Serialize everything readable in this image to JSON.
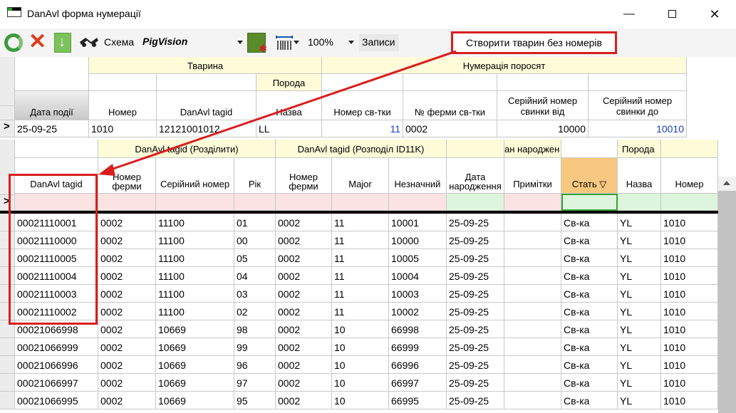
{
  "window": {
    "title": "DanAvl форма нумерації",
    "min": "—",
    "max": "",
    "close": "✕"
  },
  "toolbar": {
    "scheme_label": "Схема",
    "scheme_value": "PigVision",
    "zoom_value": "100%",
    "records_label": "Записи",
    "create_button": "Створити тварин без номерів",
    "icons": [
      "refresh-icon",
      "delete-icon",
      "download-icon",
      "scheme-icon",
      "calculator-icon",
      "barcode-icon"
    ]
  },
  "header_grid": {
    "group_animal": "Тварина",
    "group_litter": "Нумерація поросят",
    "breed_group": "Порода",
    "col_event_date": "Дата події",
    "col_number": "Номер",
    "col_tagid": "DanAvl tagid",
    "col_name": "Назва",
    "col_sow_number": "Номер св-тки",
    "col_farm_sow": "№ ферми св-тки",
    "col_serial_from": "Серійний номер свинки від",
    "col_serial_to": "Серійний номер свинки до",
    "row": {
      "marker": ">",
      "event_date": "25-09-25",
      "number": "1010",
      "tagid": "12121001012",
      "name": "LL",
      "sow_number": "11",
      "farm_sow": "0002",
      "serial_from": "10000",
      "serial_to": "10010"
    }
  },
  "lower_grid": {
    "group_split": "DanAvl tagid (Розділити)",
    "group_distribution": "DanAvl tagid (Розподіл ID11K)",
    "group_birth": "ан народжен",
    "group_breed": "Порода",
    "columns": [
      "DanAvl tagid",
      "Номер ферми",
      "Серійний номер",
      "Рік",
      "Номер ферми",
      "Major",
      "Незначний",
      "Дата народження",
      "Примітки",
      "Стать",
      "Назва",
      "Номер"
    ],
    "new_row_marker": ">",
    "rows": [
      [
        "00021110001",
        "0002",
        "11100",
        "01",
        "0002",
        "11",
        "10001",
        "25-09-25",
        "",
        "Св-ка",
        "YL",
        "1010"
      ],
      [
        "00021110000",
        "0002",
        "11100",
        "00",
        "0002",
        "11",
        "10000",
        "25-09-25",
        "",
        "Св-ка",
        "YL",
        "1010"
      ],
      [
        "00021110005",
        "0002",
        "11100",
        "05",
        "0002",
        "11",
        "10005",
        "25-09-25",
        "",
        "Св-ка",
        "YL",
        "1010"
      ],
      [
        "00021110004",
        "0002",
        "11100",
        "04",
        "0002",
        "11",
        "10004",
        "25-09-25",
        "",
        "Св-ка",
        "YL",
        "1010"
      ],
      [
        "00021110003",
        "0002",
        "11100",
        "03",
        "0002",
        "11",
        "10003",
        "25-09-25",
        "",
        "Св-ка",
        "YL",
        "1010"
      ],
      [
        "00021110002",
        "0002",
        "11100",
        "02",
        "0002",
        "11",
        "10002",
        "25-09-25",
        "",
        "Св-ка",
        "YL",
        "1010"
      ],
      [
        "00021066998",
        "0002",
        "10669",
        "98",
        "0002",
        "10",
        "66998",
        "25-09-25",
        "",
        "Св-ка",
        "YL",
        "1010"
      ],
      [
        "00021066999",
        "0002",
        "10669",
        "99",
        "0002",
        "10",
        "66999",
        "25-09-25",
        "",
        "Св-ка",
        "YL",
        "1010"
      ],
      [
        "00021066996",
        "0002",
        "10669",
        "96",
        "0002",
        "10",
        "66996",
        "25-09-25",
        "",
        "Св-ка",
        "YL",
        "1010"
      ],
      [
        "00021066997",
        "0002",
        "10669",
        "97",
        "0002",
        "10",
        "66997",
        "25-09-25",
        "",
        "Св-ка",
        "YL",
        "1010"
      ],
      [
        "00021066995",
        "0002",
        "10669",
        "95",
        "0002",
        "10",
        "66995",
        "25-09-25",
        "",
        "Св-ка",
        "YL",
        "1010"
      ]
    ]
  },
  "colors": {
    "highlight": "#d81e1e",
    "header_yellow": "#fdfbd8",
    "filter_pink": "#fbe3e3",
    "filter_green": "#dcf5dc",
    "sort_orange": "#f8c880"
  }
}
